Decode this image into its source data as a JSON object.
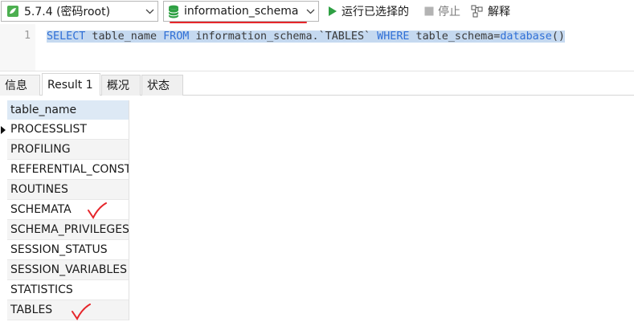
{
  "toolbar": {
    "connection": {
      "label": "5.7.4 (密码root)"
    },
    "database": {
      "label": "information_schema",
      "underline_color": "#e6262b"
    },
    "run_label": "运行已选择的",
    "stop_label": "停止",
    "explain_label": "解释",
    "icons": [
      "connection-icon",
      "database-icon",
      "play-icon",
      "stop-icon",
      "explain-icon"
    ]
  },
  "editor": {
    "line_number": "1",
    "code": {
      "kw_select": "SELECT",
      "t1": " table_name ",
      "kw_from": "FROM",
      "t2": " information_schema.`TABLES` ",
      "kw_where": "WHERE",
      "t3": " table_schema=",
      "kw_db": "database",
      "t4": "()"
    }
  },
  "tabs": [
    {
      "label": "信息"
    },
    {
      "label": "Result 1"
    },
    {
      "label": "概况"
    },
    {
      "label": "状态"
    }
  ],
  "grid": {
    "column": "table_name",
    "rows": [
      {
        "value": "PROCESSLIST",
        "current": true
      },
      {
        "value": "PROFILING"
      },
      {
        "value": "REFERENTIAL_CONSTRAINTS"
      },
      {
        "value": "ROUTINES"
      },
      {
        "value": "SCHEMATA",
        "checked": true
      },
      {
        "value": "SCHEMA_PRIVILEGES"
      },
      {
        "value": "SESSION_STATUS"
      },
      {
        "value": "SESSION_VARIABLES"
      },
      {
        "value": "STATISTICS"
      },
      {
        "value": "TABLES",
        "checked": true
      }
    ]
  },
  "colors": {
    "accent_blue": "#2f6fd6",
    "selection": "#c5d9f0",
    "run_green": "#2ea043",
    "annotation_red": "#e6262b"
  }
}
